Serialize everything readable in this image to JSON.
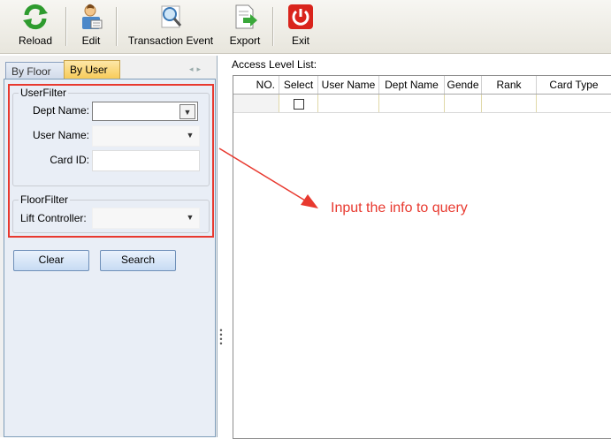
{
  "toolbar": {
    "buttons": [
      {
        "label": "Reload",
        "icon": "reload-icon"
      },
      {
        "label": "Edit",
        "icon": "edit-user-icon"
      },
      {
        "label": "Transaction Event",
        "icon": "magnifier-icon"
      },
      {
        "label": "Export",
        "icon": "export-icon"
      },
      {
        "label": "Exit",
        "icon": "power-icon"
      }
    ]
  },
  "left_panel": {
    "tabs": [
      {
        "label": "By Floor",
        "active": false
      },
      {
        "label": "By User",
        "active": true
      }
    ],
    "user_filter": {
      "title": "UserFilter",
      "dept_name_label": "Dept Name:",
      "dept_name_value": "",
      "user_name_label": "User Name:",
      "user_name_value": "",
      "card_id_label": "Card ID:",
      "card_id_value": ""
    },
    "floor_filter": {
      "title": "FloorFilter",
      "lift_controller_label": "Lift Controller:",
      "lift_controller_value": ""
    },
    "clear_label": "Clear",
    "search_label": "Search"
  },
  "main": {
    "title": "Access Level List:",
    "columns": [
      "NO.",
      "Select",
      "User Name",
      "Dept Name",
      "Gende",
      "Rank",
      "Card Type"
    ],
    "rows": [
      {
        "no": "",
        "select": false,
        "user_name": "",
        "dept_name": "",
        "gender": "",
        "rank": "",
        "card_type": ""
      }
    ]
  },
  "annotation": {
    "text": "Input the info to query",
    "color": "#e8392f"
  }
}
